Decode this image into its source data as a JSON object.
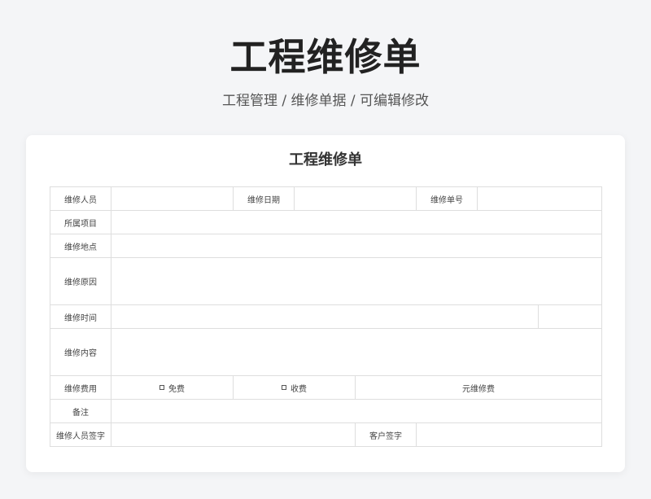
{
  "header": {
    "title": "工程维修单",
    "subtitle": "工程管理 / 维修单据 /  可编辑修改"
  },
  "form": {
    "title": "工程维修单",
    "labels": {
      "repair_person": "维修人员",
      "repair_date": "维修日期",
      "repair_number": "维修单号",
      "project": "所属项目",
      "location": "维修地点",
      "reason": "维修原因",
      "time": "维修时间",
      "content": "维修内容",
      "fee": "维修费用",
      "remarks": "备注",
      "repairer_signature": "维修人员签字",
      "customer_signature": "客户签字"
    },
    "fee_options": {
      "free": "免费",
      "charge": "收费",
      "unit": "元维修费"
    },
    "values": {
      "repair_person": "",
      "repair_date": "",
      "repair_number": "",
      "project": "",
      "location": "",
      "reason": "",
      "time_start": "",
      "time_end": "",
      "content": "",
      "fee_amount": "",
      "remarks": "",
      "repairer_signature": "",
      "customer_signature": ""
    }
  }
}
